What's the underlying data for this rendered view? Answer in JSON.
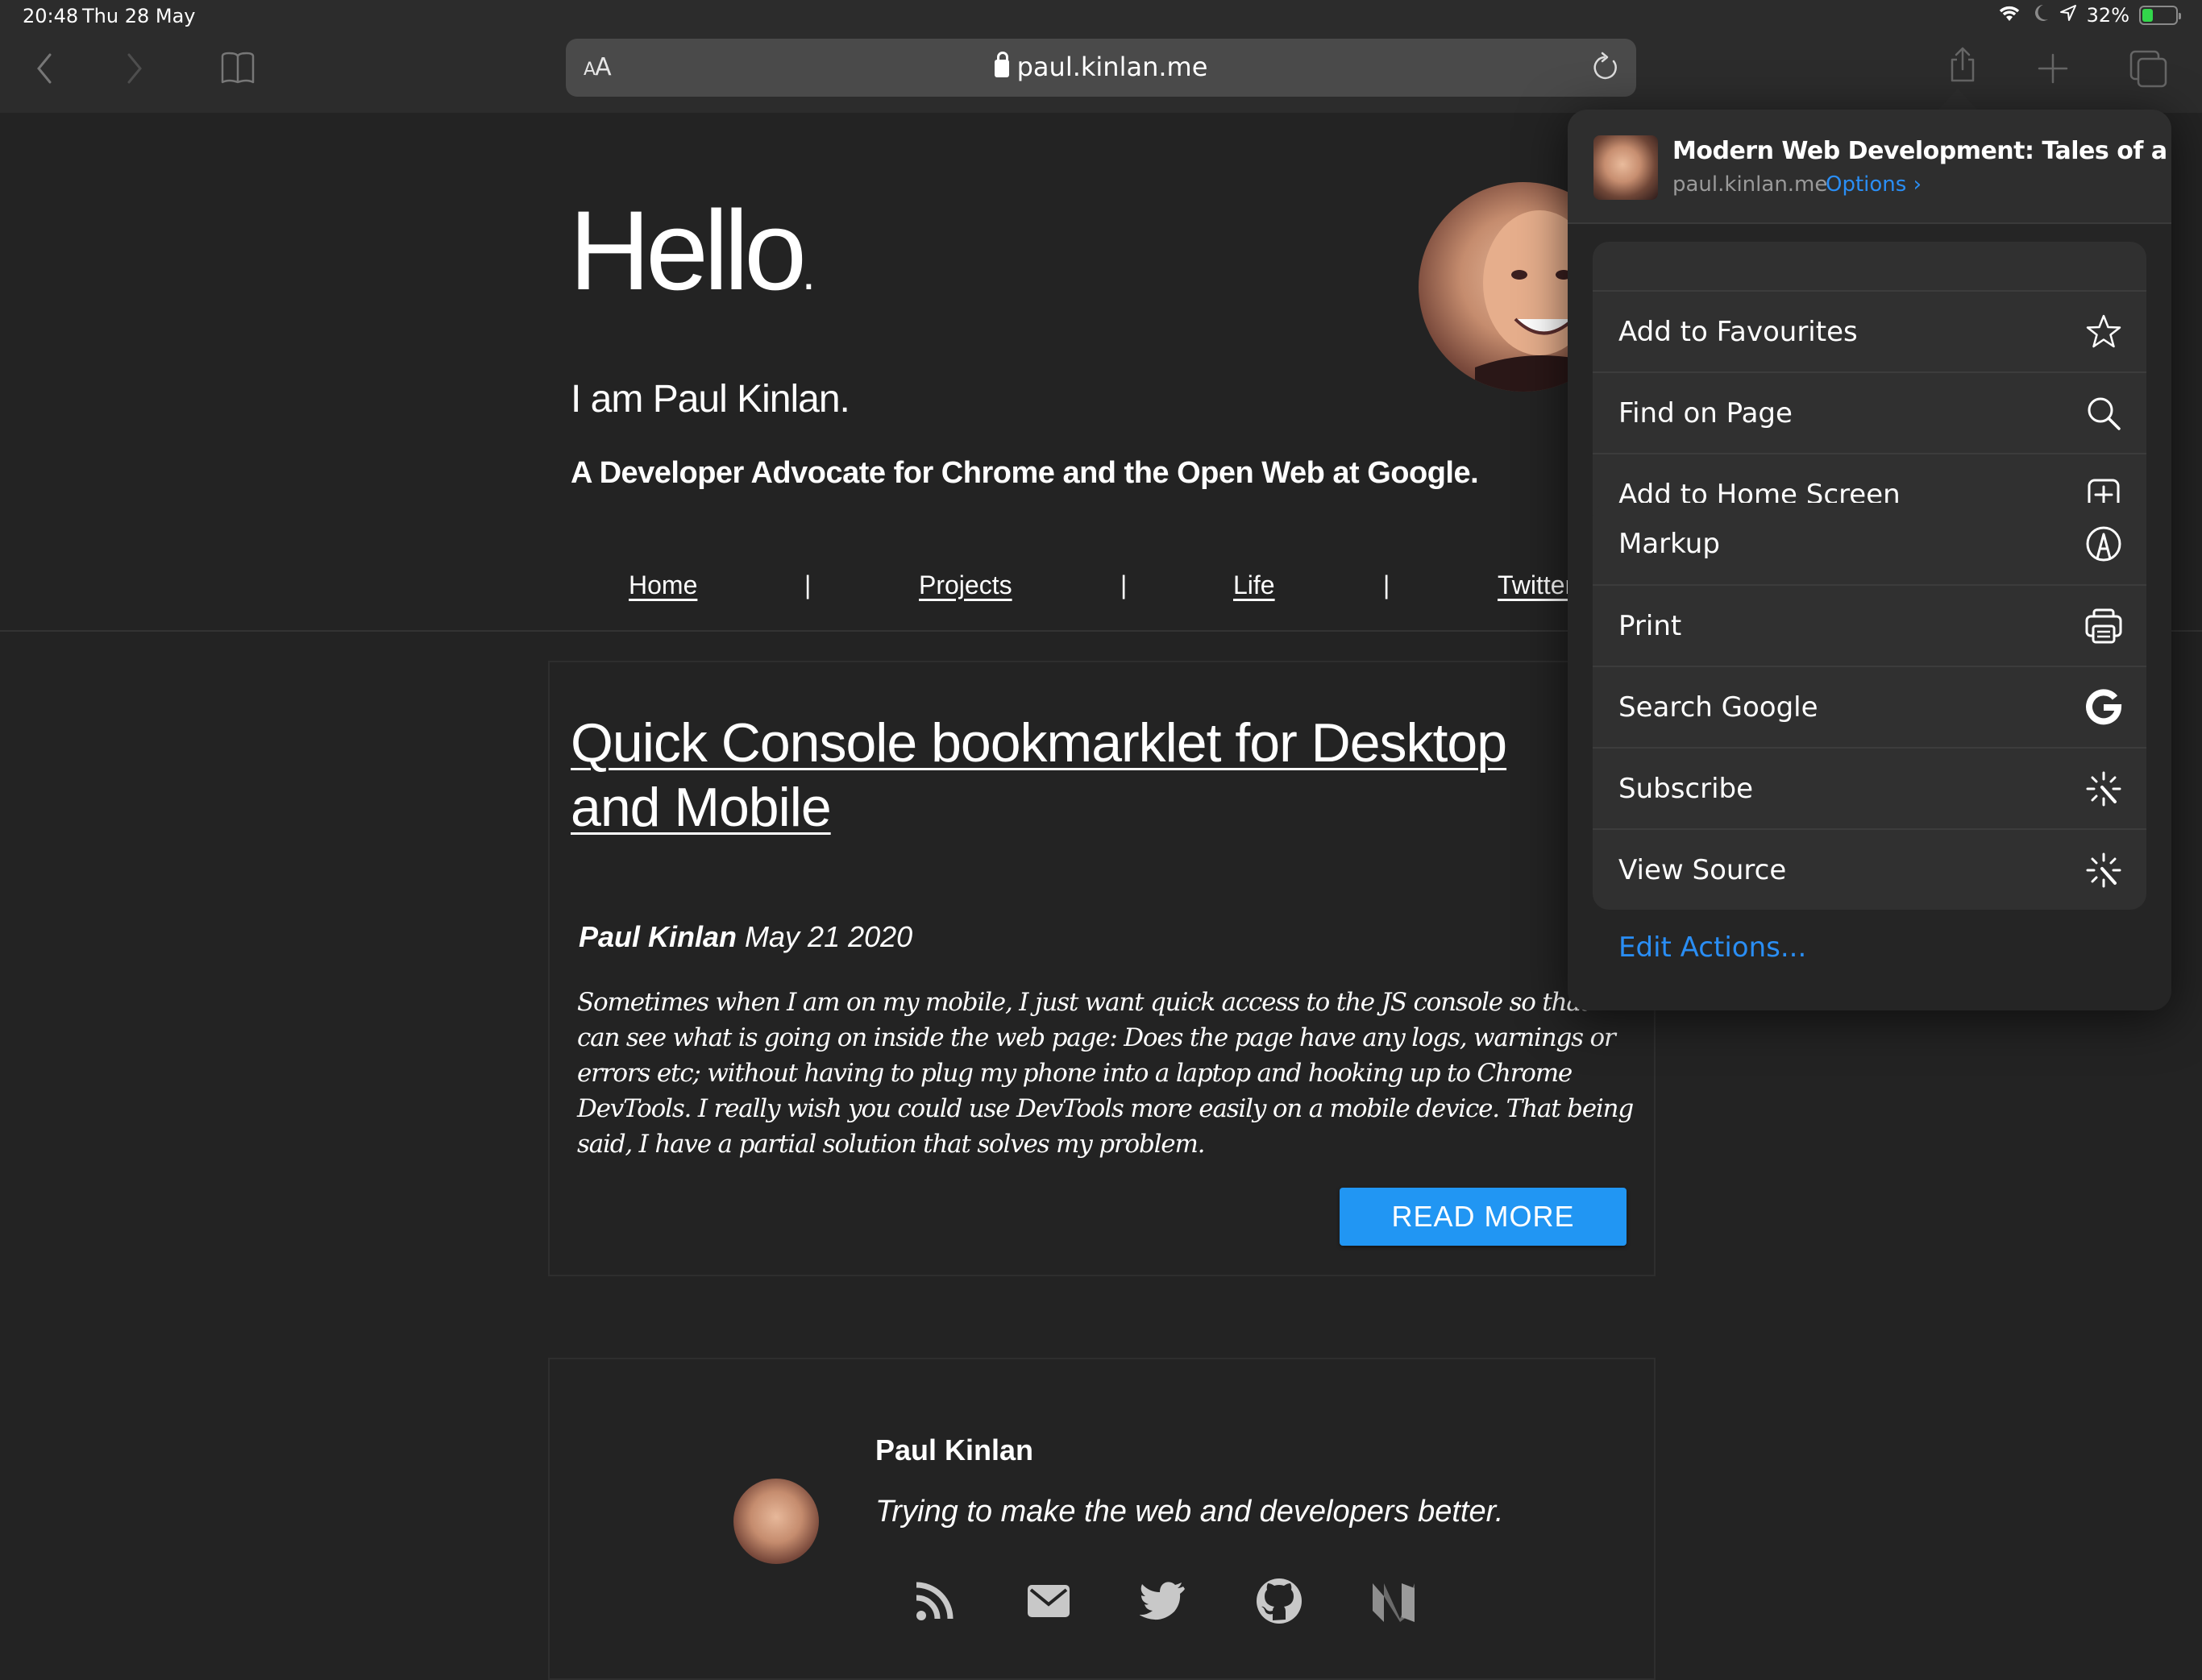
{
  "status_bar": {
    "time": "20:48",
    "date": "Thu 28 May",
    "battery_percent": "32%",
    "battery_level": 0.32,
    "battery_charging": true,
    "icons": [
      "wifi-icon",
      "do-not-disturb-moon-icon",
      "location-arrow-icon",
      "battery-icon"
    ]
  },
  "toolbar": {
    "back_icon": "chevron-left-icon",
    "forward_icon": "chevron-right-icon",
    "bookmarks_icon": "book-icon",
    "reader_label_small": "A",
    "reader_label_large": "A",
    "url": "paul.kinlan.me",
    "reload_icon": "reload-icon",
    "share_icon": "share-icon",
    "new_tab_icon": "plus-icon",
    "tabs_icon": "tabs-icon"
  },
  "page": {
    "hello": "Hello",
    "hello_dot": ".",
    "intro": "I am Paul Kinlan.",
    "tagline": "A Developer Advocate for Chrome and the Open Web at Google.",
    "nav": [
      {
        "label": "Home"
      },
      {
        "label": "Projects"
      },
      {
        "label": "Life"
      },
      {
        "label": "Twitter"
      }
    ],
    "nav_separator": "|",
    "article": {
      "title": "Quick Console bookmarklet for Desktop and Mobile",
      "author": "Paul Kinlan",
      "date": "May 21 2020",
      "excerpt": "Sometimes when I am on my mobile, I just want quick access to the JS console so that I can see what is going on inside the web page: Does the page have any logs, warnings or errors etc; without having to plug my phone into a laptop and hooking up to Chrome DevTools. I really wish you could use DevTools more easily on a mobile device. That being said, I have a partial solution that solves my problem.",
      "read_more": "READ MORE"
    },
    "author_card": {
      "name": "Paul Kinlan",
      "bio": "Trying to make the web and developers better.",
      "social": [
        "rss-icon",
        "email-icon",
        "twitter-icon",
        "github-icon",
        "medium-icon"
      ]
    }
  },
  "share_sheet": {
    "title": "Modern Web Development: Tales of a D...",
    "domain": "paul.kinlan.me",
    "options_label": "Options",
    "groups": [
      [
        {
          "label": "Add to Favourites",
          "icon": "star-icon"
        },
        {
          "label": "Find on Page",
          "icon": "search-icon"
        },
        {
          "label": "Add to Home Screen",
          "icon": "add-square-icon"
        }
      ],
      [
        {
          "label": "Markup",
          "icon": "markup-pen-icon"
        },
        {
          "label": "Print",
          "icon": "printer-icon"
        },
        {
          "label": "Search Google",
          "icon": "google-icon"
        },
        {
          "label": "Subscribe",
          "icon": "shortcut-wand-icon"
        },
        {
          "label": "View Source",
          "icon": "shortcut-wand-icon"
        }
      ]
    ],
    "edit_actions": "Edit Actions..."
  },
  "colors": {
    "accent_blue": "#2a8ef5",
    "read_more_blue": "#2196f3",
    "page_bg": "#232323",
    "toolbar_bg": "#2c2c2c",
    "battery_green": "#32d74b"
  }
}
